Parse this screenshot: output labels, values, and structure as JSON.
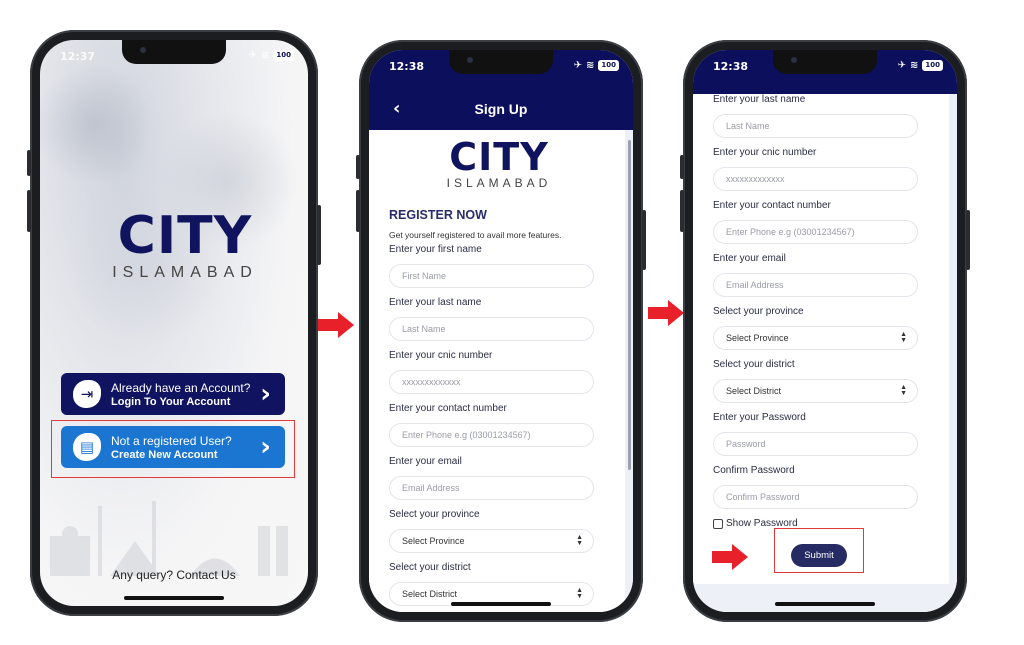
{
  "colors": {
    "brand_navy": "#0b0f5c",
    "login_button": "#101360",
    "create_button": "#1b76d2",
    "submit_button": "#262b63",
    "highlight": "#e23a3a"
  },
  "logo": {
    "word": "CITY",
    "subtitle": "ISLAMABAD"
  },
  "screen1": {
    "status_time": "12:37",
    "battery": "100",
    "login_cta": {
      "icon": "login-icon",
      "line1": "Already have an Account?",
      "line2": "Login To Your Account",
      "chevron": "›"
    },
    "create_cta": {
      "icon": "id-card-icon",
      "line1": "Not a registered User?",
      "line2": "Create New Account",
      "chevron": "›"
    },
    "contact": "Any query? Contact Us"
  },
  "screen2": {
    "status_time": "12:38",
    "battery": "100",
    "back": "‹",
    "title": "Sign Up",
    "heading": "REGISTER NOW",
    "subheading": "Get yourself registered to avail more features.",
    "fields": [
      {
        "label": "Enter your first name",
        "placeholder": "First Name"
      },
      {
        "label": "Enter your last name",
        "placeholder": "Last Name"
      },
      {
        "label": "Enter your cnic number",
        "placeholder": "xxxxxxxxxxxxx"
      },
      {
        "label": "Enter your contact number",
        "placeholder": "Enter Phone e.g (03001234567)"
      },
      {
        "label": "Enter your email",
        "placeholder": "Email Address"
      },
      {
        "label": "Select your province",
        "value": "Select Province"
      },
      {
        "label": "Select your district",
        "value": "Select District"
      }
    ]
  },
  "screen3": {
    "status_time": "12:38",
    "battery": "100",
    "fields": [
      {
        "label": "Enter your last name",
        "placeholder": "Last Name"
      },
      {
        "label": "Enter your cnic number",
        "placeholder": "xxxxxxxxxxxxx"
      },
      {
        "label": "Enter your contact number",
        "placeholder": "Enter Phone e.g (03001234567)"
      },
      {
        "label": "Enter your email",
        "placeholder": "Email Address"
      },
      {
        "label": "Select your province",
        "value": "Select Province"
      },
      {
        "label": "Select your district",
        "value": "Select District"
      },
      {
        "label": "Enter your Password",
        "placeholder": "Password"
      },
      {
        "label": "Confirm Password",
        "placeholder": "Confirm Password"
      }
    ],
    "show_password": "Show Password",
    "submit": "Submit"
  }
}
